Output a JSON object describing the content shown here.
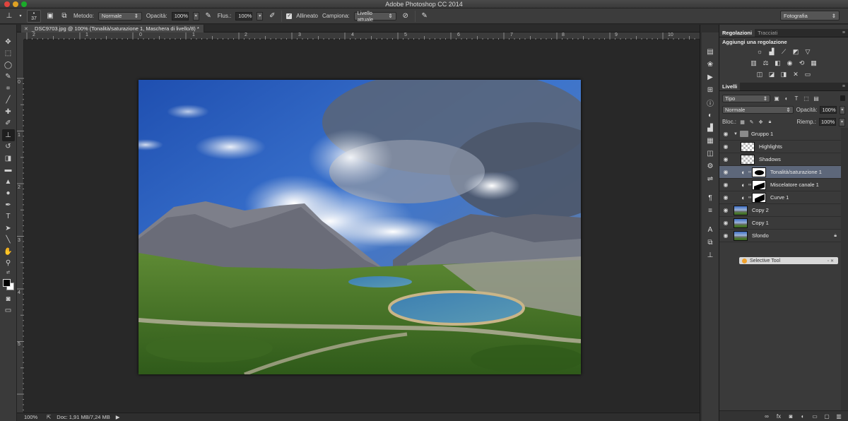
{
  "window": {
    "title": "Adobe Photoshop CC 2014"
  },
  "options": {
    "brush_size": "37",
    "mode_label": "Metodo:",
    "mode_value": "Normale",
    "opacity_label": "Opacità:",
    "opacity_value": "100%",
    "flow_label": "Flus.:",
    "flow_value": "100%",
    "aligned_label": "Allineato",
    "sample_label": "Campiona:",
    "sample_value": "Livello attuale",
    "workspace": "Fotografia"
  },
  "document": {
    "tab_title": "_DSC9703.jpg @ 100% (Tonalità/saturazione 1, Maschera di livello/8) *",
    "zoom": "100%",
    "doc_size": "Doc: 1,91 MB/7,24 MB"
  },
  "rulers": {
    "top": [
      "2",
      "1",
      "0",
      "1",
      "2",
      "3",
      "4",
      "5",
      "6",
      "7",
      "8",
      "9",
      "10"
    ],
    "left": [
      "0",
      "1",
      "2",
      "3",
      "4",
      "5"
    ]
  },
  "adjustments": {
    "tabs": [
      "Regolazioni",
      "Tracciati"
    ],
    "title": "Aggiungi una regolazione"
  },
  "layers_panel": {
    "tab": "Livelli",
    "filter": "Tipo",
    "blend": "Normale",
    "opacity_label": "Opacità:",
    "opacity_value": "100%",
    "lock_label": "Bloc.:",
    "fill_label": "Riemp.:",
    "fill_value": "100%",
    "layers": [
      {
        "name": "Gruppo 1"
      },
      {
        "name": "Highlights"
      },
      {
        "name": "Shadows"
      },
      {
        "name": "Tonalità/saturazione 1"
      },
      {
        "name": "Miscelatore canale 1"
      },
      {
        "name": "Curve 1"
      },
      {
        "name": "Copy 2"
      },
      {
        "name": "Copy 1"
      },
      {
        "name": "Sfondo"
      }
    ]
  },
  "selective_tool": {
    "title": "Selective Tool"
  },
  "colors": {
    "selected_layer": "#5d677a",
    "panel_bg": "#3a3a3a",
    "canvas_bg": "#282828"
  }
}
